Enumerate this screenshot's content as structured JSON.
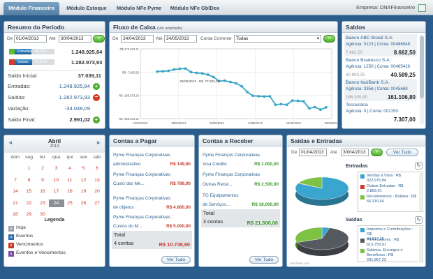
{
  "nav": {
    "tabs": [
      "Módulo Financeiro",
      "Módulo Estoque",
      "Módulo NFe Pyme",
      "Módulo NFe GblDox"
    ],
    "empresa_label": "Empresa:",
    "empresa_value": "DNAFinanceiro"
  },
  "resumo": {
    "title": "Resumo do Período",
    "de_label": "De",
    "ate_label": "Até",
    "date_from": "01/04/2013",
    "date_to": "30/04/2013",
    "entradas_bar_label": "Entradas",
    "entradas_bar_pct": "49,33%",
    "entradas_bar_fraction": 0.4933,
    "entradas_bar_value": "1.248.925,84",
    "saidas_bar_label": "Saídas",
    "saidas_bar_pct": "50,67%",
    "saidas_bar_fraction": 0.5067,
    "saidas_bar_value": "1.282.973,93",
    "rows": [
      {
        "label": "Saldo Inicial:",
        "value": "37.039,11"
      },
      {
        "label": "Entradas:",
        "value": "1.248.925,84"
      },
      {
        "label": "Saídas:",
        "value": "1.282.973,93"
      },
      {
        "label": "Variação:",
        "value": "-34.048,09"
      },
      {
        "label": "Saldo Final:",
        "value": "2.991,02"
      }
    ]
  },
  "fluxo": {
    "title": "Fluxo de Caixa",
    "subtitle": "(Ver ampliado)",
    "de_label": "De",
    "ate_label": "Até",
    "date_from": "24/04/2013",
    "date_to": "24/05/2013",
    "conta_label": "Conta Corrente",
    "conta_value": "Todas",
    "tooltip": "05/05/2013 - R$ -77.683,38"
  },
  "chart_data": {
    "type": "line",
    "y_ticks": [
      "R$ 173.222,71",
      "R$ -7.665,26",
      "R$ -188.573,24",
      "R$ -369.481,21"
    ],
    "x_ticks": [
      "21/04/2013",
      "28/04/2013",
      "05/05/2013",
      "12/05/2013",
      "19/05/2013",
      "25/05/2013"
    ],
    "ylim": [
      -369481.21,
      173222.71
    ],
    "x_start_day": -3,
    "x_end_day": 31,
    "x": [
      0,
      1,
      2,
      3,
      4,
      5,
      6,
      7,
      8,
      9,
      10,
      11,
      12,
      13,
      14,
      15,
      16,
      17,
      18,
      19,
      20,
      21,
      22,
      23,
      24,
      25,
      26,
      27,
      28,
      29,
      30
    ],
    "y": [
      -4000,
      -2000,
      2000,
      12000,
      18000,
      20000,
      -8000,
      -14000,
      -18000,
      -28000,
      -46000,
      -77683,
      -75000,
      -85000,
      -95000,
      -118000,
      -163000,
      -192000,
      -195000,
      -198000,
      -196000,
      -262000,
      -257000,
      -262000,
      -230000,
      -232000,
      -236000,
      -290000,
      -280000,
      -300000,
      -282000
    ],
    "grid": true
  },
  "saldos": {
    "title": "Saldos",
    "banks": [
      {
        "name": "Banco ABC Brasil S.A.",
        "agencia": "Agência: 0123 | Conta: 00486548",
        "left": "7.462,50",
        "balance": "8.662,50"
      },
      {
        "name": "Banco Bradesco S.A.",
        "agencia": "Agência: 1250 | Conta: 00465416",
        "left": "40.899,25",
        "balance": "40.589,25"
      },
      {
        "name": "Banco ItaúBank S.A.",
        "agencia": "Agência: 0356 | Conta: 0045668",
        "left": "166.300,80",
        "balance": "161.106,80"
      },
      {
        "name": "Tesouraria",
        "agencia": "Agência: 0 | Conta: 002150",
        "left": "",
        "balance": "7.307,00"
      }
    ]
  },
  "calendario": {
    "month": "Abril",
    "year": "2013",
    "weekdays": [
      "dom",
      "seg",
      "ter",
      "qua",
      "qui",
      "sex",
      "sáb"
    ],
    "rows": [
      [
        "",
        "1",
        "2",
        "3",
        "4",
        "5",
        "6"
      ],
      [
        "7",
        "8",
        "9",
        "10",
        "11",
        "12",
        "13"
      ],
      [
        "14",
        "15",
        "16",
        "17",
        "18",
        "19",
        "20"
      ],
      [
        "21",
        "22",
        "23",
        "24",
        "25",
        "26",
        "27"
      ],
      [
        "28",
        "29",
        "30",
        "",
        "",
        "",
        ""
      ]
    ],
    "legend_title": "Legenda",
    "legend": [
      {
        "label": "Hoje",
        "color": "#9aa3ad"
      },
      {
        "label": "Eventos",
        "color": "#2f6fb0"
      },
      {
        "label": "Vencimentos",
        "color": "#c83b2a"
      },
      {
        "label": "Eventos e Vencimentos",
        "color": "#7a4b9e"
      }
    ]
  },
  "pagar": {
    "title": "Contas a Pagar",
    "items": [
      {
        "text": "Pyme Finanças Corporativas",
        "amount": ""
      },
      {
        "text": "administrativo",
        "amount": "R$ 149,90"
      },
      {
        "text": "Pyme Finanças Corporativas",
        "amount": ""
      },
      {
        "text": "Custo das Me...",
        "amount": "R$ 799,00"
      },
      {
        "text": "Pyme Finanças Corporativas",
        "amount": ""
      },
      {
        "text": "de objetos",
        "amount": "R$ 4.800,00"
      },
      {
        "text": "Pyme Finanças Corporativas",
        "amount": ""
      },
      {
        "text": "Custos do M...",
        "amount": "R$ 5.000,00"
      }
    ],
    "total_label": "Total",
    "total_count": "4 contas",
    "total_value": "R$ 10.748,90",
    "ver_tudo": "Ver Tudo"
  },
  "receber": {
    "title": "Contas a Receber",
    "items": [
      {
        "text": "Pyme Finanças Corporativas",
        "amount": ""
      },
      {
        "text": "Visa Crédito",
        "amount": "R$ 1.000,00"
      },
      {
        "text": "Pyme Finanças Corporativas",
        "amount": ""
      },
      {
        "text": "Outras Recei...",
        "amount": "R$ 2.500,00"
      },
      {
        "text": "TG Equipamentos",
        "amount": ""
      },
      {
        "text": "de Serviços...",
        "amount": "R$ 18.000,00"
      }
    ],
    "total_label": "Total",
    "total_count": "3 contas",
    "total_value": "R$ 21.500,00",
    "ver_tudo": "Ver Tudo"
  },
  "saidas_entradas": {
    "title": "Saídas e Entradas",
    "de_label": "De",
    "ate_label": "Até",
    "date_from": "01/04/2013",
    "date_to": "30/04/2013",
    "ver_tudo": "Ver Tudo",
    "entradas_title": "Entradas",
    "entradas_legend": [
      {
        "name": "Vendas à Vista : R$",
        "value": "322.975,84",
        "color": "#3aa6d0"
      },
      {
        "name": "Outras Entradas : R$",
        "value": "2.863,91",
        "color": "#d23a2a"
      },
      {
        "name": "Recebimentos - Boletos : R$",
        "value": "66.316,64",
        "color": "#7dc242"
      }
    ],
    "saidas_title": "Saídas",
    "saidas_legend": [
      {
        "name": "Impostos e Contribuições : R$",
        "value": "44.817,15",
        "color": "#3aa6d0"
      },
      {
        "name": "Fornecedores : R$",
        "value": "615.759,91",
        "color": "#555a60"
      },
      {
        "name": "Salários, Encargos e Benefícios : R$",
        "value": "291.867,23",
        "color": "#7dc242"
      }
    ],
    "footer": "amcharts.com"
  }
}
